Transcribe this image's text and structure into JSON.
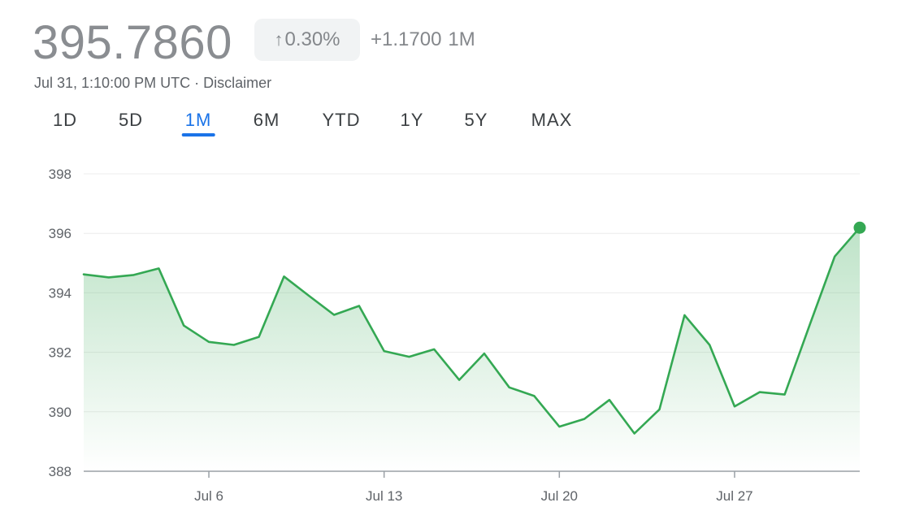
{
  "quote": {
    "price": "395.7860",
    "change_percent": "0.30%",
    "change_abs": "+1.1700",
    "period": "1M",
    "timestamp": "Jul 31, 1:10:00 PM UTC",
    "separator": "·",
    "disclaimer": "Disclaimer",
    "trend": "up"
  },
  "tabs": [
    {
      "label": "1D",
      "active": false
    },
    {
      "label": "5D",
      "active": false
    },
    {
      "label": "1M",
      "active": true
    },
    {
      "label": "6M",
      "active": false
    },
    {
      "label": "YTD",
      "active": false
    },
    {
      "label": "1Y",
      "active": false
    },
    {
      "label": "5Y",
      "active": false
    },
    {
      "label": "MAX",
      "active": false
    }
  ],
  "colors": {
    "line": "#34a853",
    "accent": "#1a73e8",
    "grid": "#ececec",
    "axis": "#9aa0a6",
    "text": "#5f6368"
  },
  "chart_data": {
    "type": "area",
    "x": [
      "Jul 1",
      "Jul 2",
      "Jul 3",
      "Jul 4",
      "Jul 5",
      "Jul 6",
      "Jul 7",
      "Jul 8",
      "Jul 9",
      "Jul 10",
      "Jul 11",
      "Jul 12",
      "Jul 13",
      "Jul 14",
      "Jul 15",
      "Jul 16",
      "Jul 17",
      "Jul 18",
      "Jul 19",
      "Jul 20",
      "Jul 21",
      "Jul 22",
      "Jul 23",
      "Jul 24",
      "Jul 25",
      "Jul 26",
      "Jul 27",
      "Jul 28",
      "Jul 29",
      "Jul 30",
      "Jul 31"
    ],
    "values": [
      394.62,
      394.52,
      394.6,
      394.82,
      392.9,
      392.35,
      392.25,
      392.52,
      394.55,
      393.9,
      393.26,
      393.56,
      392.04,
      391.85,
      392.1,
      391.07,
      391.96,
      390.82,
      390.53,
      389.5,
      389.76,
      390.4,
      389.27,
      390.08,
      393.25,
      392.25,
      390.18,
      390.66,
      390.58,
      392.92,
      395.22,
      396.19
    ],
    "ticks_x": [
      "Jul 6",
      "Jul 13",
      "Jul 20",
      "Jul 27"
    ],
    "ticks_y": [
      388,
      390,
      392,
      394,
      396,
      398
    ],
    "ylim": [
      388,
      398
    ],
    "grid": true,
    "last_point_marker": true
  }
}
